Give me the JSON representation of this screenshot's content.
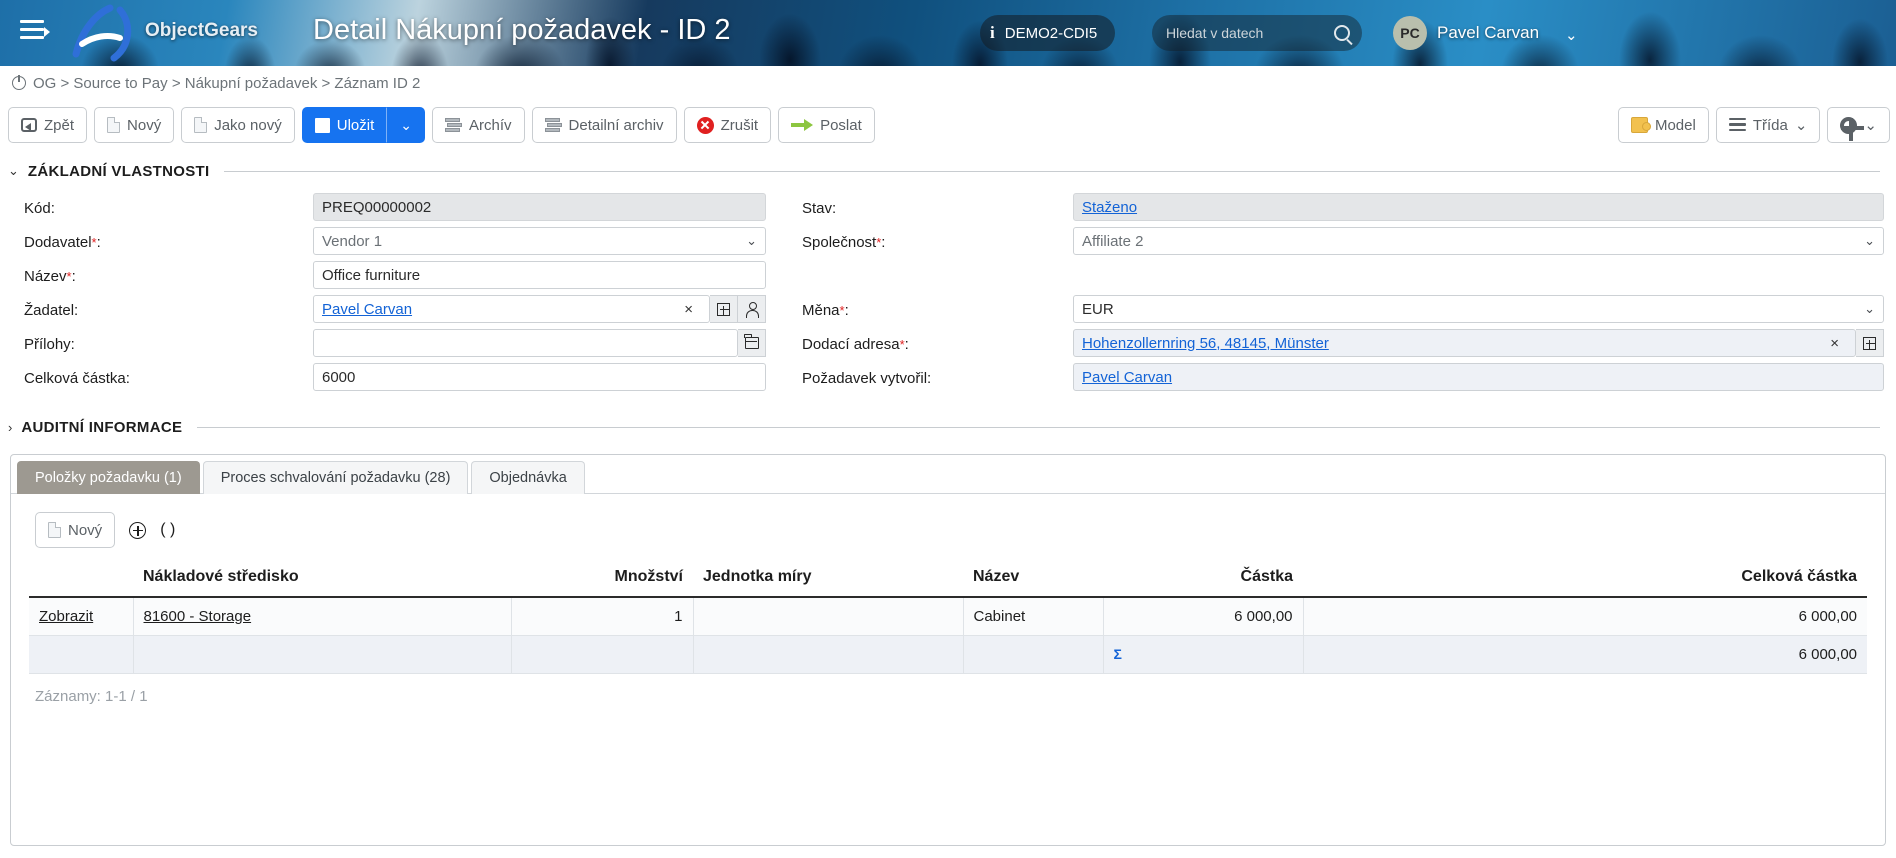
{
  "header": {
    "menu_icon": "hamburger-icon",
    "brand": "ObjectGears",
    "title": "Detail Nákupní požadavek - ID 2",
    "environment": "DEMO2-CDI5",
    "info_icon": "info-icon",
    "search_placeholder": "Hledat v datech",
    "search_value": "",
    "search_icon": "search-icon",
    "avatar_initials": "PC",
    "user_name": "Pavel Carvan",
    "user_caret": "⌄"
  },
  "breadcrumb": {
    "icon": "power-icon",
    "text": "OG > Source to Pay > Nákupní požadavek > Záznam ID 2"
  },
  "toolbar": {
    "back": "Zpět",
    "new": "Nový",
    "save_as_new": "Jako nový",
    "save": "Uložit",
    "save_caret": "⌄",
    "archive": "Archív",
    "detail_archive": "Detailní archiv",
    "cancel": "Zrušit",
    "send": "Poslat",
    "model": "Model",
    "class": "Třída",
    "class_caret": "⌄",
    "gear_caret": "⌄"
  },
  "sections": {
    "basic": {
      "chevron": "⌄",
      "title": "ZÁKLADNÍ VLASTNOSTI"
    },
    "audit": {
      "chevron": "›",
      "title": "AUDITNÍ INFORMACE"
    }
  },
  "form": {
    "kod": {
      "label": "Kód:",
      "value": "PREQ00000002"
    },
    "dodavatel": {
      "label": "Dodavatel",
      "required": "*",
      "colon": ":",
      "value": "Vendor 1",
      "caret": "⌄"
    },
    "nazev": {
      "label": "Název",
      "required": "*",
      "colon": ":",
      "value": "Office furniture"
    },
    "zadatel": {
      "label": "Žadatel:",
      "value": "Pavel Carvan",
      "clear": "×",
      "add_icon": "plus-box-icon",
      "person_icon": "person-icon"
    },
    "prilohy": {
      "label": "Přílohy:",
      "value": "",
      "folder_icon": "folder-icon"
    },
    "celkova_castka": {
      "label": "Celková částka:",
      "value": "6000"
    },
    "stav": {
      "label": "Stav:",
      "value": "Staženo"
    },
    "spolecnost": {
      "label": "Společnost",
      "required": "*",
      "colon": ":",
      "value": "Affiliate 2",
      "caret": "⌄"
    },
    "mena": {
      "label": "Měna",
      "required": "*",
      "colon": ":",
      "value": "EUR",
      "caret": "⌄"
    },
    "dodaci_adresa": {
      "label": "Dodací adresa",
      "required": "*",
      "colon": ":",
      "value": "Hohenzollernring 56, 48145, Münster",
      "clear": "×",
      "add_icon": "plus-box-icon"
    },
    "pozadavek_vytvoril": {
      "label": "Požadavek vytvořil:",
      "value": "Pavel Carvan"
    }
  },
  "tabs": [
    {
      "label": "Položky požadavku (1)",
      "active": true
    },
    {
      "label": "Proces schvalování požadavku (28)",
      "active": false
    },
    {
      "label": "Objednávka",
      "active": false
    }
  ],
  "grid_toolbar": {
    "new": "Nový",
    "expand_icon": "plus-circle-icon",
    "paren": "( )"
  },
  "table": {
    "columns": [
      "",
      "Nákladové středisko",
      "Množství",
      "Jednotka míry",
      "Název",
      "Částka",
      "Celková částka"
    ],
    "rows": [
      {
        "action": "Zobrazit",
        "cost_center": "81600 - Storage",
        "quantity": "1",
        "unit": "",
        "name": "Cabinet",
        "amount": "6 000,00",
        "total": "6 000,00"
      }
    ],
    "summary": {
      "sigma": "Σ",
      "total": "6 000,00"
    },
    "records": "Záznamy: 1-1 / 1"
  }
}
